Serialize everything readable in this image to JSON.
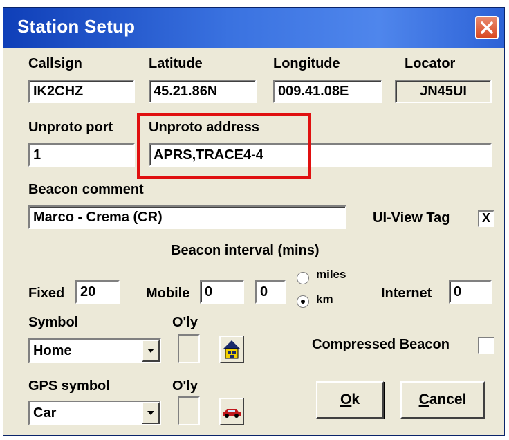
{
  "window": {
    "title": "Station Setup",
    "close_icon": "close-icon"
  },
  "station": {
    "callsign": {
      "label": "Callsign",
      "value": "IK2CHZ"
    },
    "latitude": {
      "label": "Latitude",
      "value": "45.21.86N"
    },
    "longitude": {
      "label": "Longitude",
      "value": "009.41.08E"
    },
    "locator": {
      "label": "Locator",
      "value": "JN45UI"
    }
  },
  "unproto": {
    "port_label": "Unproto port",
    "port_value": "1",
    "address_label": "Unproto address",
    "address_value": "APRS,TRACE4-4"
  },
  "beacon": {
    "comment_label": "Beacon comment",
    "comment_value": "Marco - Crema (CR)",
    "uiview_tag_label": "UI-View Tag",
    "uiview_tag_checked": "X"
  },
  "interval": {
    "group_label": "Beacon interval (mins)",
    "fixed_label": "Fixed",
    "fixed_value": "20",
    "mobile_label": "Mobile",
    "mobile_value1": "0",
    "mobile_value2": "0",
    "miles_label": "miles",
    "km_label": "km",
    "selected_unit": "km",
    "internet_label": "Internet",
    "internet_value": "0"
  },
  "symbol": {
    "label": "Symbol",
    "overlay_label": "O'ly",
    "value": "Home",
    "icon": "house-icon",
    "compressed_label": "Compressed Beacon"
  },
  "gps_symbol": {
    "label": "GPS symbol",
    "overlay_label": "O'ly",
    "value": "Car",
    "icon": "car-icon"
  },
  "buttons": {
    "ok": {
      "accel": "O",
      "rest": "k"
    },
    "cancel": {
      "accel": "C",
      "rest": "ancel"
    }
  },
  "colors": {
    "highlight": "#e01010",
    "dialog_bg": "#ece9d8",
    "titlebar": "#3a72e0"
  }
}
